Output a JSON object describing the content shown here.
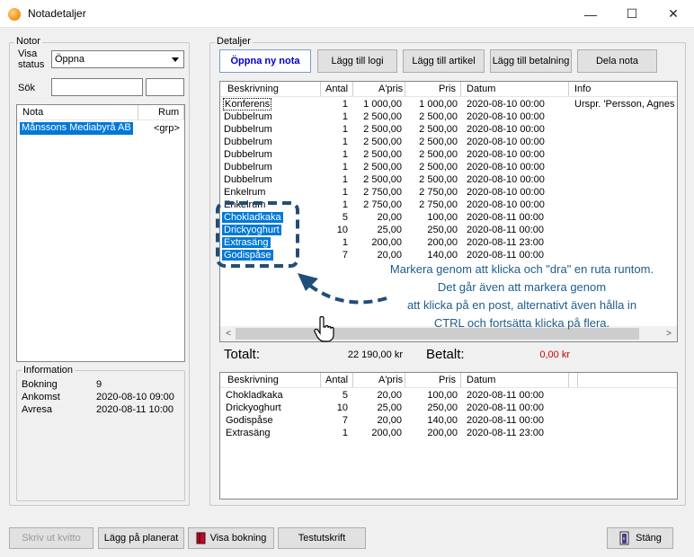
{
  "window": {
    "title": "Notadetaljer",
    "minimize_glyph": "—",
    "maximize_glyph": "☐",
    "close_glyph": "✕"
  },
  "notor": {
    "group_label": "Notor",
    "visa_status_label_1": "Visa",
    "visa_status_label_2": "status",
    "status_value": "Öppna",
    "sok_label": "Sök",
    "sok_value": "",
    "sok_value2": "",
    "list_headers": {
      "nota": "Nota",
      "rum": "Rum"
    },
    "rows": [
      {
        "nota": "Månssons Mediabyrå AB",
        "rum": "<grp>"
      }
    ]
  },
  "information": {
    "group_label": "Information",
    "rows": [
      {
        "label": "Bokning",
        "value": "9"
      },
      {
        "label": "Ankomst",
        "value": "2020-08-10 09:00"
      },
      {
        "label": "Avresa",
        "value": "2020-08-11 10:00"
      }
    ]
  },
  "detaljer": {
    "group_label": "Detaljer",
    "buttons": {
      "open_new": "Öppna ny nota",
      "add_logi": "Lägg till logi",
      "add_artikel": "Lägg till artikel",
      "add_betalning": "Lägg till betalning",
      "split": "Dela nota"
    },
    "headers": {
      "beskrivning": "Beskrivning",
      "antal": "Antal",
      "apris": "A'pris",
      "pris": "Pris",
      "datum": "Datum",
      "info": "Info"
    },
    "rows": [
      {
        "beskrivning": "Konferens",
        "antal": "1",
        "apris": "1 000,00",
        "pris": "1 000,00",
        "datum": "2020-08-10 00:00",
        "info": "Urspr. 'Persson, Agnes (",
        "selected": false,
        "focused": true
      },
      {
        "beskrivning": "Dubbelrum",
        "antal": "1",
        "apris": "2 500,00",
        "pris": "2 500,00",
        "datum": "2020-08-10 00:00",
        "info": "",
        "selected": false
      },
      {
        "beskrivning": "Dubbelrum",
        "antal": "1",
        "apris": "2 500,00",
        "pris": "2 500,00",
        "datum": "2020-08-10 00:00",
        "info": "",
        "selected": false
      },
      {
        "beskrivning": "Dubbelrum",
        "antal": "1",
        "apris": "2 500,00",
        "pris": "2 500,00",
        "datum": "2020-08-10 00:00",
        "info": "",
        "selected": false
      },
      {
        "beskrivning": "Dubbelrum",
        "antal": "1",
        "apris": "2 500,00",
        "pris": "2 500,00",
        "datum": "2020-08-10 00:00",
        "info": "",
        "selected": false
      },
      {
        "beskrivning": "Dubbelrum",
        "antal": "1",
        "apris": "2 500,00",
        "pris": "2 500,00",
        "datum": "2020-08-10 00:00",
        "info": "",
        "selected": false
      },
      {
        "beskrivning": "Dubbelrum",
        "antal": "1",
        "apris": "2 500,00",
        "pris": "2 500,00",
        "datum": "2020-08-10 00:00",
        "info": "",
        "selected": false
      },
      {
        "beskrivning": "Enkelrum",
        "antal": "1",
        "apris": "2 750,00",
        "pris": "2 750,00",
        "datum": "2020-08-10 00:00",
        "info": "",
        "selected": false
      },
      {
        "beskrivning": "Enkelrum",
        "antal": "1",
        "apris": "2 750,00",
        "pris": "2 750,00",
        "datum": "2020-08-10 00:00",
        "info": "",
        "selected": false
      },
      {
        "beskrivning": "Chokladkaka",
        "antal": "5",
        "apris": "20,00",
        "pris": "100,00",
        "datum": "2020-08-11 00:00",
        "info": "",
        "selected": true
      },
      {
        "beskrivning": "Drickyoghurt",
        "antal": "10",
        "apris": "25,00",
        "pris": "250,00",
        "datum": "2020-08-11 00:00",
        "info": "",
        "selected": true
      },
      {
        "beskrivning": "Extrasäng",
        "antal": "1",
        "apris": "200,00",
        "pris": "200,00",
        "datum": "2020-08-11 23:00",
        "info": "",
        "selected": true
      },
      {
        "beskrivning": "Godispåse",
        "antal": "7",
        "apris": "20,00",
        "pris": "140,00",
        "datum": "2020-08-11 00:00",
        "info": "",
        "selected": true
      }
    ],
    "annotation": {
      "line1": "Markera genom att klicka och \"dra\" en ruta runtom.",
      "line2": "Det går även att markera genom",
      "line3": "att klicka på en post, alternativt även hålla in",
      "line4": "CTRL och fortsätta klicka på flera.",
      "color": "#1f5c8b"
    },
    "totalt_label": "Totalt:",
    "totalt_value": "22 190,00 kr",
    "betalt_label": "Betalt:",
    "betalt_value": "0,00 kr",
    "betalt_color": "#cc0000"
  },
  "selection": {
    "headers": {
      "beskrivning": "Beskrivning",
      "antal": "Antal",
      "apris": "A'pris",
      "pris": "Pris",
      "datum": "Datum"
    },
    "rows": [
      {
        "beskrivning": "Chokladkaka",
        "antal": "5",
        "apris": "20,00",
        "pris": "100,00",
        "datum": "2020-08-11 00:00"
      },
      {
        "beskrivning": "Drickyoghurt",
        "antal": "10",
        "apris": "25,00",
        "pris": "250,00",
        "datum": "2020-08-11 00:00"
      },
      {
        "beskrivning": "Godispåse",
        "antal": "7",
        "apris": "20,00",
        "pris": "140,00",
        "datum": "2020-08-11 00:00"
      },
      {
        "beskrivning": "Extrasäng",
        "antal": "1",
        "apris": "200,00",
        "pris": "200,00",
        "datum": "2020-08-11 23:00"
      }
    ]
  },
  "footer": {
    "print_receipt": "Skriv ut kvitto",
    "add_planned": "Lägg på planerat",
    "show_booking": "Visa bokning",
    "test_print": "Testutskrift",
    "close": "Stäng"
  },
  "icons": {
    "app": "app-icon",
    "dropdown": "chevron-down-icon",
    "book": "book-icon",
    "door": "door-exit-icon",
    "cursor": "hand-cursor-icon"
  }
}
